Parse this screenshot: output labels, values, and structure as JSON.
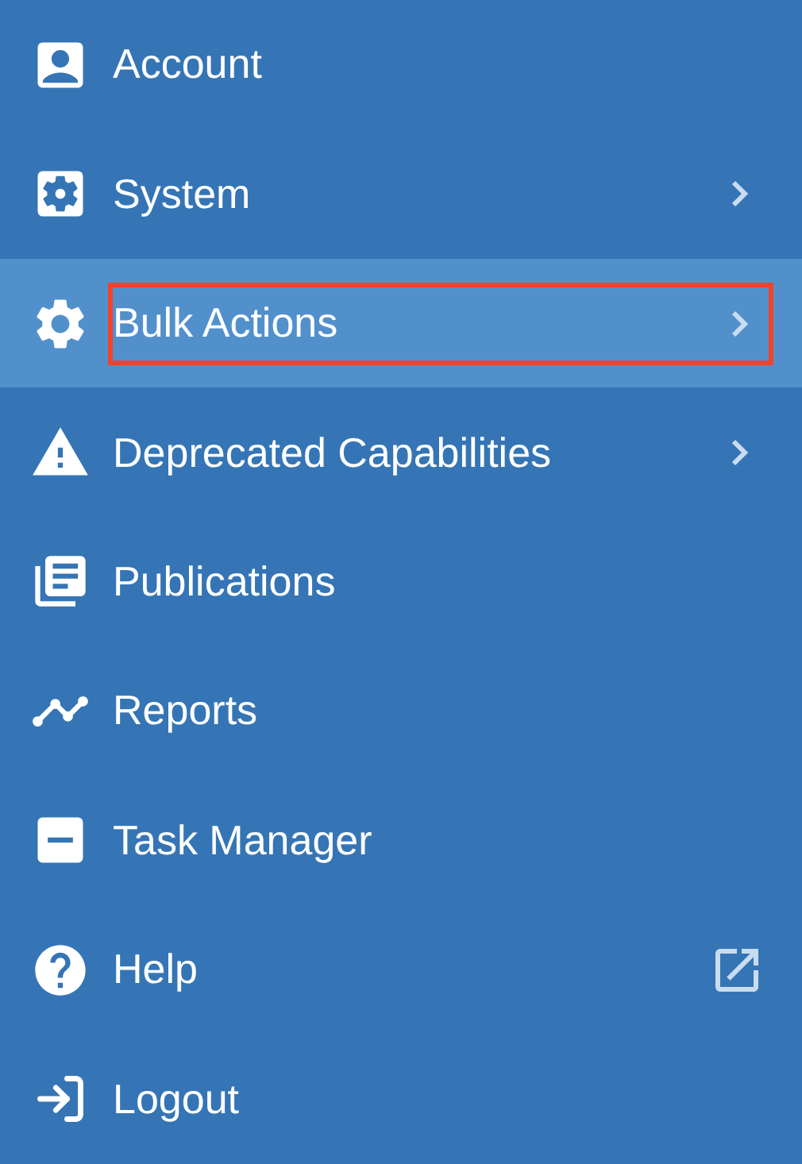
{
  "menu": {
    "items": [
      {
        "label": "Account",
        "submenu": false,
        "external": false,
        "selected": false,
        "highlighted": false
      },
      {
        "label": "System",
        "submenu": true,
        "external": false,
        "selected": false,
        "highlighted": false
      },
      {
        "label": "Bulk Actions",
        "submenu": true,
        "external": false,
        "selected": true,
        "highlighted": true
      },
      {
        "label": "Deprecated Capabilities",
        "submenu": true,
        "external": false,
        "selected": false,
        "highlighted": false
      },
      {
        "label": "Publications",
        "submenu": false,
        "external": false,
        "selected": false,
        "highlighted": false
      },
      {
        "label": "Reports",
        "submenu": false,
        "external": false,
        "selected": false,
        "highlighted": false
      },
      {
        "label": "Task Manager",
        "submenu": false,
        "external": false,
        "selected": false,
        "highlighted": false
      },
      {
        "label": "Help",
        "submenu": false,
        "external": true,
        "selected": false,
        "highlighted": false
      },
      {
        "label": "Logout",
        "submenu": false,
        "external": false,
        "selected": false,
        "highlighted": false
      }
    ]
  }
}
